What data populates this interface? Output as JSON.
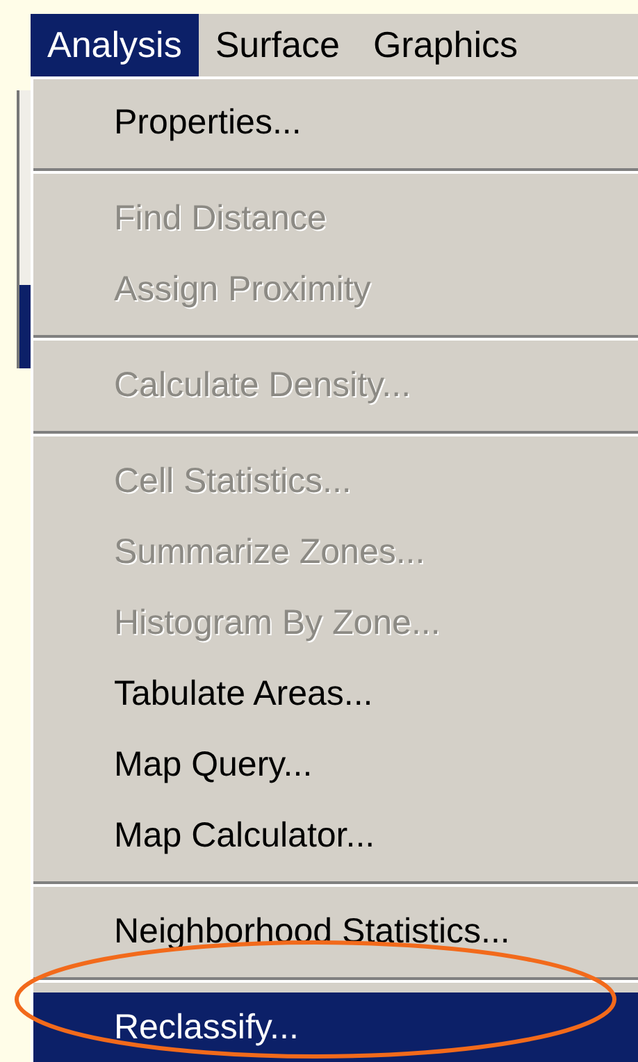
{
  "menu_bar": [
    {
      "label": "Analysis",
      "selected": true
    },
    {
      "label": "Surface",
      "selected": false
    },
    {
      "label": "Graphics",
      "selected": false
    }
  ],
  "menu": [
    {
      "kind": "item",
      "label": "Properties...",
      "disabled": false,
      "selected": false
    },
    {
      "kind": "separator"
    },
    {
      "kind": "item",
      "label": "Find Distance",
      "disabled": true,
      "selected": false
    },
    {
      "kind": "item",
      "label": "Assign Proximity",
      "disabled": true,
      "selected": false
    },
    {
      "kind": "separator"
    },
    {
      "kind": "item",
      "label": "Calculate Density...",
      "disabled": true,
      "selected": false
    },
    {
      "kind": "separator"
    },
    {
      "kind": "item",
      "label": "Cell Statistics...",
      "disabled": true,
      "selected": false
    },
    {
      "kind": "item",
      "label": "Summarize Zones...",
      "disabled": true,
      "selected": false
    },
    {
      "kind": "item",
      "label": "Histogram By Zone...",
      "disabled": true,
      "selected": false
    },
    {
      "kind": "item",
      "label": "Tabulate Areas...",
      "disabled": false,
      "selected": false
    },
    {
      "kind": "item",
      "label": "Map Query...",
      "disabled": false,
      "selected": false
    },
    {
      "kind": "item",
      "label": "Map Calculator...",
      "disabled": false,
      "selected": false
    },
    {
      "kind": "separator"
    },
    {
      "kind": "item",
      "label": "Neighborhood Statistics...",
      "disabled": false,
      "selected": false
    },
    {
      "kind": "separator"
    },
    {
      "kind": "item",
      "label": "Reclassify...",
      "disabled": false,
      "selected": true
    }
  ]
}
